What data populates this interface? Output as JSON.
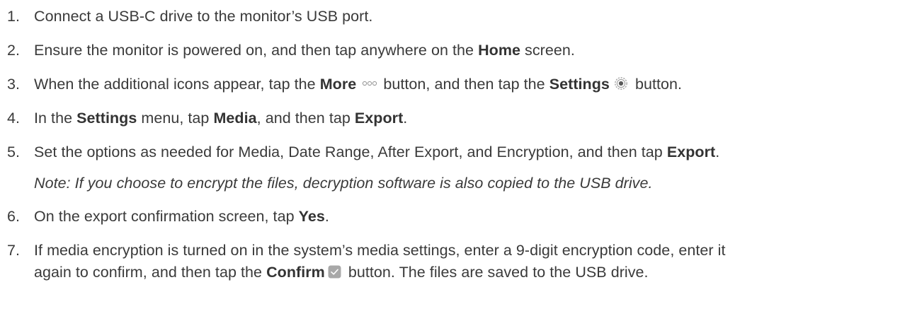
{
  "steps": [
    {
      "number": "1.",
      "text": "Connect a USB-C drive to the monitor’s USB port."
    },
    {
      "number": "2.",
      "pre": "Ensure the monitor is powered on, and then tap anywhere on the ",
      "bold1": "Home",
      "post": " screen."
    },
    {
      "number": "3.",
      "pre": "When the additional icons appear, tap the ",
      "bold1": "More",
      "mid": " button, and then tap the ",
      "bold2": "Settings",
      "post": " button.",
      "icon1": "more-dots-icon",
      "icon2": "settings-gear-icon"
    },
    {
      "number": "4.",
      "pre": "In the ",
      "bold1": "Settings",
      "mid1": " menu, tap ",
      "bold2": "Media",
      "mid2": ", and then tap ",
      "bold3": "Export",
      "post": "."
    },
    {
      "number": "5.",
      "pre": "Set the options as needed for Media, Date Range, After Export, and Encryption, and then tap ",
      "bold1": "Export",
      "post": ".",
      "note": "Note: If you choose to encrypt the files, decryption software is also copied to the USB drive."
    },
    {
      "number": "6.",
      "pre": "On the export confirmation screen, tap ",
      "bold1": "Yes",
      "post": "."
    },
    {
      "number": "7.",
      "line1": "If media encryption is turned on in the system’s media settings, enter a 9-digit encryption code, enter it",
      "pre": "again to confirm, and then tap the ",
      "bold1": "Confirm",
      "post": " button. The files are saved to the USB drive.",
      "icon1": "confirm-check-icon"
    }
  ],
  "colors": {
    "text": "#3a3a3a",
    "icon_gray": "#9a9a9a",
    "check_bg": "#a8a8a8"
  }
}
